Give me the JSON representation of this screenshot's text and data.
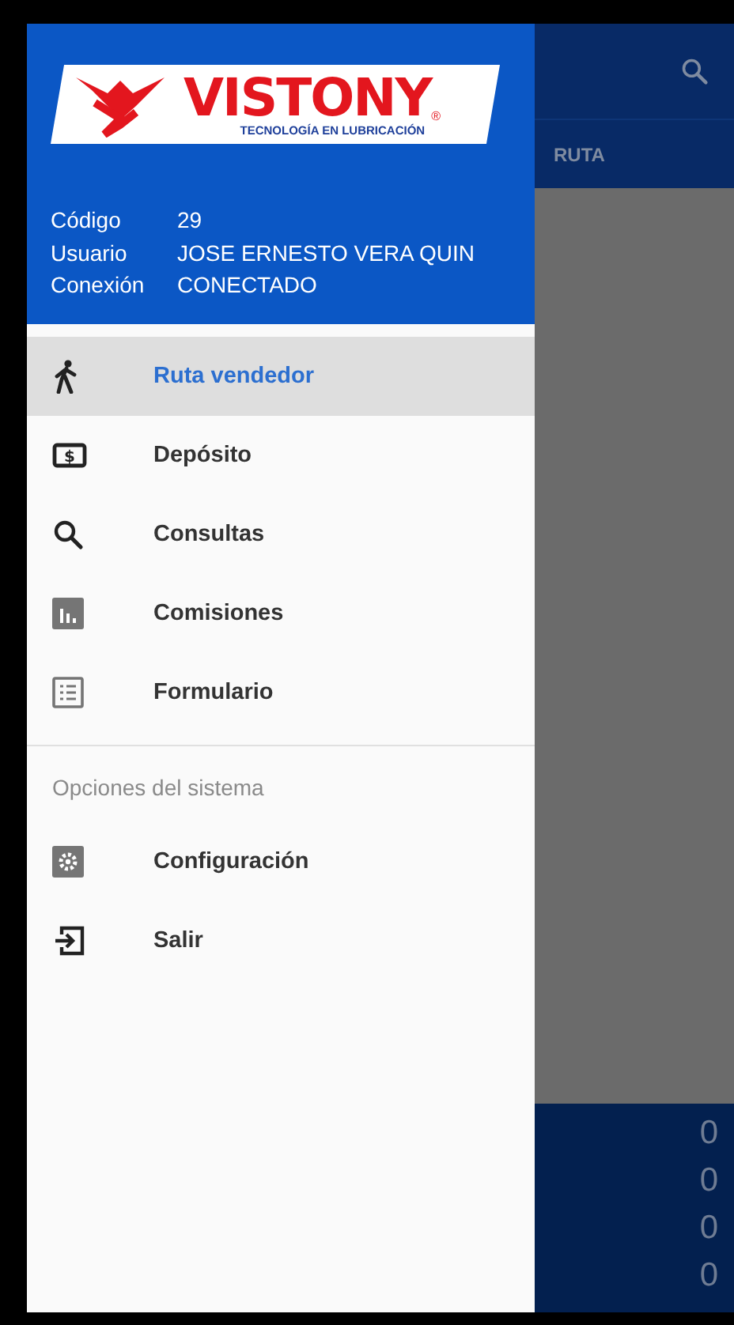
{
  "drawer": {
    "logo": {
      "title": "VISTONY",
      "mark": "®",
      "tagline": "TECNOLOGÍA EN LUBRICACIÓN"
    },
    "user_info": [
      {
        "label": "Código",
        "value": "29"
      },
      {
        "label": "Usuario",
        "value": "JOSE ERNESTO VERA QUIN"
      },
      {
        "label": "Conexión",
        "value": "CONECTADO"
      }
    ],
    "menu": [
      {
        "kind": "walk",
        "label": "Ruta vendedor",
        "selected": true
      },
      {
        "kind": "money",
        "symbol": "$",
        "label": "Depósito",
        "selected": false
      },
      {
        "kind": "search",
        "label": "Consultas",
        "selected": false
      },
      {
        "kind": "chart",
        "label": "Comisiones",
        "selected": false
      },
      {
        "kind": "list",
        "label": "Formulario",
        "selected": false
      }
    ],
    "section_header": "Opciones del sistema",
    "system_menu": [
      {
        "kind": "settings",
        "label": "Configuración",
        "selected": false
      },
      {
        "kind": "exit",
        "label": "Salir",
        "selected": false
      }
    ]
  },
  "background": {
    "header_label": "RUTA",
    "totals": [
      "0",
      "0",
      "0",
      "0"
    ]
  }
}
